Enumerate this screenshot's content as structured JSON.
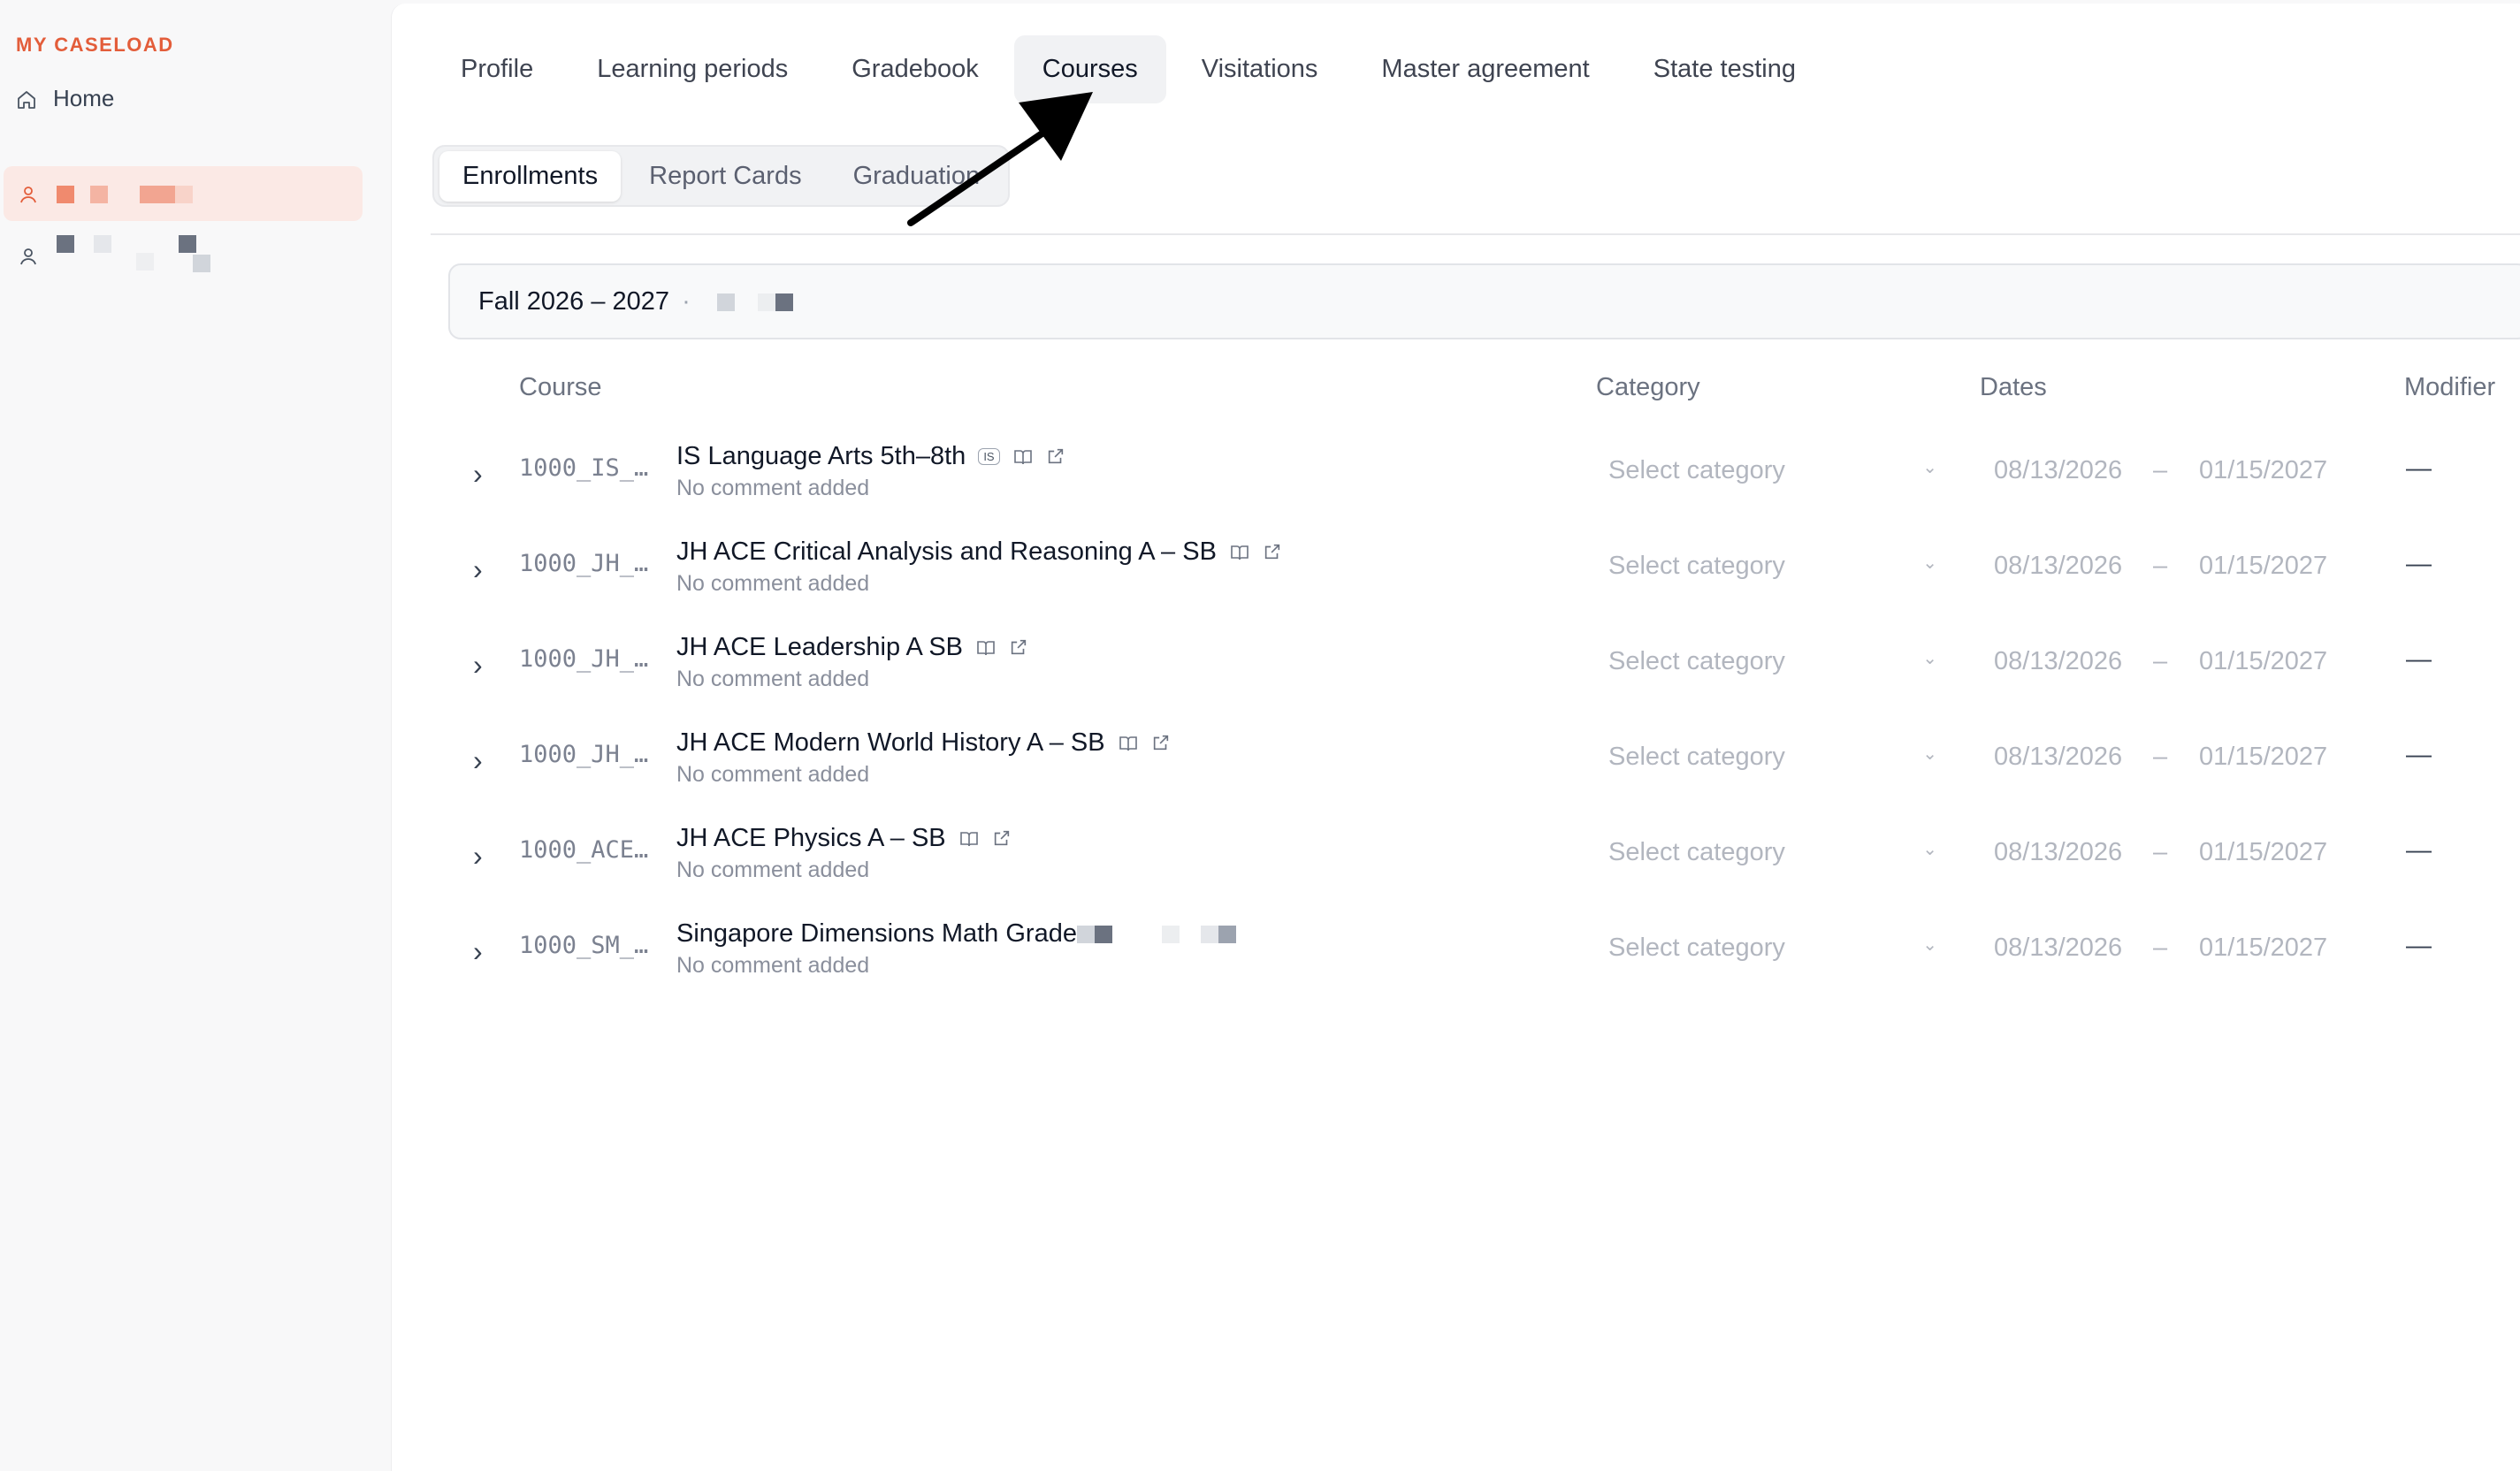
{
  "sidebar": {
    "section_title": "MY CASELOAD",
    "home_label": "Home"
  },
  "tabs": [
    "Profile",
    "Learning periods",
    "Gradebook",
    "Courses",
    "Visitations",
    "Master agreement",
    "State testing"
  ],
  "active_tab": "Courses",
  "subtabs": [
    "Enrollments",
    "Report Cards",
    "Graduation"
  ],
  "active_subtab": "Enrollments",
  "term": {
    "label": "Fall 2026 – 2027",
    "separator": "·"
  },
  "table": {
    "headers": {
      "course": "Course",
      "category": "Category",
      "dates": "Dates",
      "modifier": "Modifier"
    },
    "rows": [
      {
        "code": "1000_IS_…",
        "title": "IS Language Arts 5th–8th",
        "badge": "IS",
        "comment": "No comment added",
        "category": "Select category",
        "start": "08/13/2026",
        "dash": "–",
        "end": "01/15/2027",
        "modifier": "—"
      },
      {
        "code": "1000_JH_…",
        "title": "JH ACE Critical Analysis and Reasoning A – SB",
        "badge": "",
        "comment": "No comment added",
        "category": "Select category",
        "start": "08/13/2026",
        "dash": "–",
        "end": "01/15/2027",
        "modifier": "—"
      },
      {
        "code": "1000_JH_…",
        "title": "JH ACE Leadership A SB",
        "badge": "",
        "comment": "No comment added",
        "category": "Select category",
        "start": "08/13/2026",
        "dash": "–",
        "end": "01/15/2027",
        "modifier": "—"
      },
      {
        "code": "1000_JH_…",
        "title": "JH ACE Modern World History A – SB",
        "badge": "",
        "comment": "No comment added",
        "category": "Select category",
        "start": "08/13/2026",
        "dash": "–",
        "end": "01/15/2027",
        "modifier": "—"
      },
      {
        "code": "1000_ACE…",
        "title": "JH ACE Physics A – SB",
        "badge": "",
        "comment": "No comment added",
        "category": "Select category",
        "start": "08/13/2026",
        "dash": "–",
        "end": "01/15/2027",
        "modifier": "—"
      },
      {
        "code": "1000_SM_…",
        "title": "Singapore Dimensions Math Grade",
        "badge": "",
        "comment": "No comment added",
        "category": "Select category",
        "start": "08/13/2026",
        "dash": "–",
        "end": "01/15/2027",
        "modifier": "—"
      }
    ]
  },
  "colors": {
    "accent": "#e35d3a",
    "active_student_bg": "#fbe9e5"
  }
}
